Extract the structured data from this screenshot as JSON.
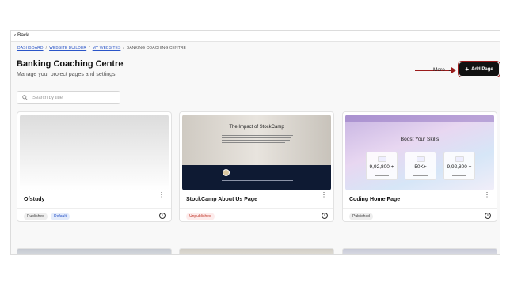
{
  "nav": {
    "back_label": "Back"
  },
  "breadcrumb": [
    {
      "label": "DASHBOARD",
      "link": true
    },
    {
      "label": "WEBSITE BUILDER",
      "link": true
    },
    {
      "label": "MY WEBSITES",
      "link": true
    },
    {
      "label": "BANKING COACHING CENTRE",
      "link": false
    }
  ],
  "page": {
    "title": "Banking Coaching Centre",
    "subtitle": "Manage your project pages and settings"
  },
  "toolbar": {
    "more_label": "More",
    "add_page_label": "Add Page",
    "search_placeholder": "Search by title"
  },
  "cards": [
    {
      "name": "Ofstudy",
      "status": "Published",
      "default_badge": "Default"
    },
    {
      "name": "StockCamp About Us Page",
      "status": "Unpublished",
      "thumb_title": "The Impact of StockCamp"
    },
    {
      "name": "Coding Home Page",
      "status": "Published",
      "thumb_title": "Boost Your Skills",
      "thumb_stats": [
        "9,92,800 +",
        "50K+",
        "9,92,800 +"
      ]
    }
  ],
  "colors": {
    "add_button_bg": "#111111",
    "highlight": "#9b1c1c",
    "link": "#2a55c8",
    "unpublished": "#c0392b"
  },
  "icons": {
    "back": "chevron-left-icon",
    "more": "chevron-down-icon",
    "add": "plus-icon",
    "search": "search-icon",
    "card_menu": "kebab-menu-icon",
    "card_info": "info-icon"
  }
}
